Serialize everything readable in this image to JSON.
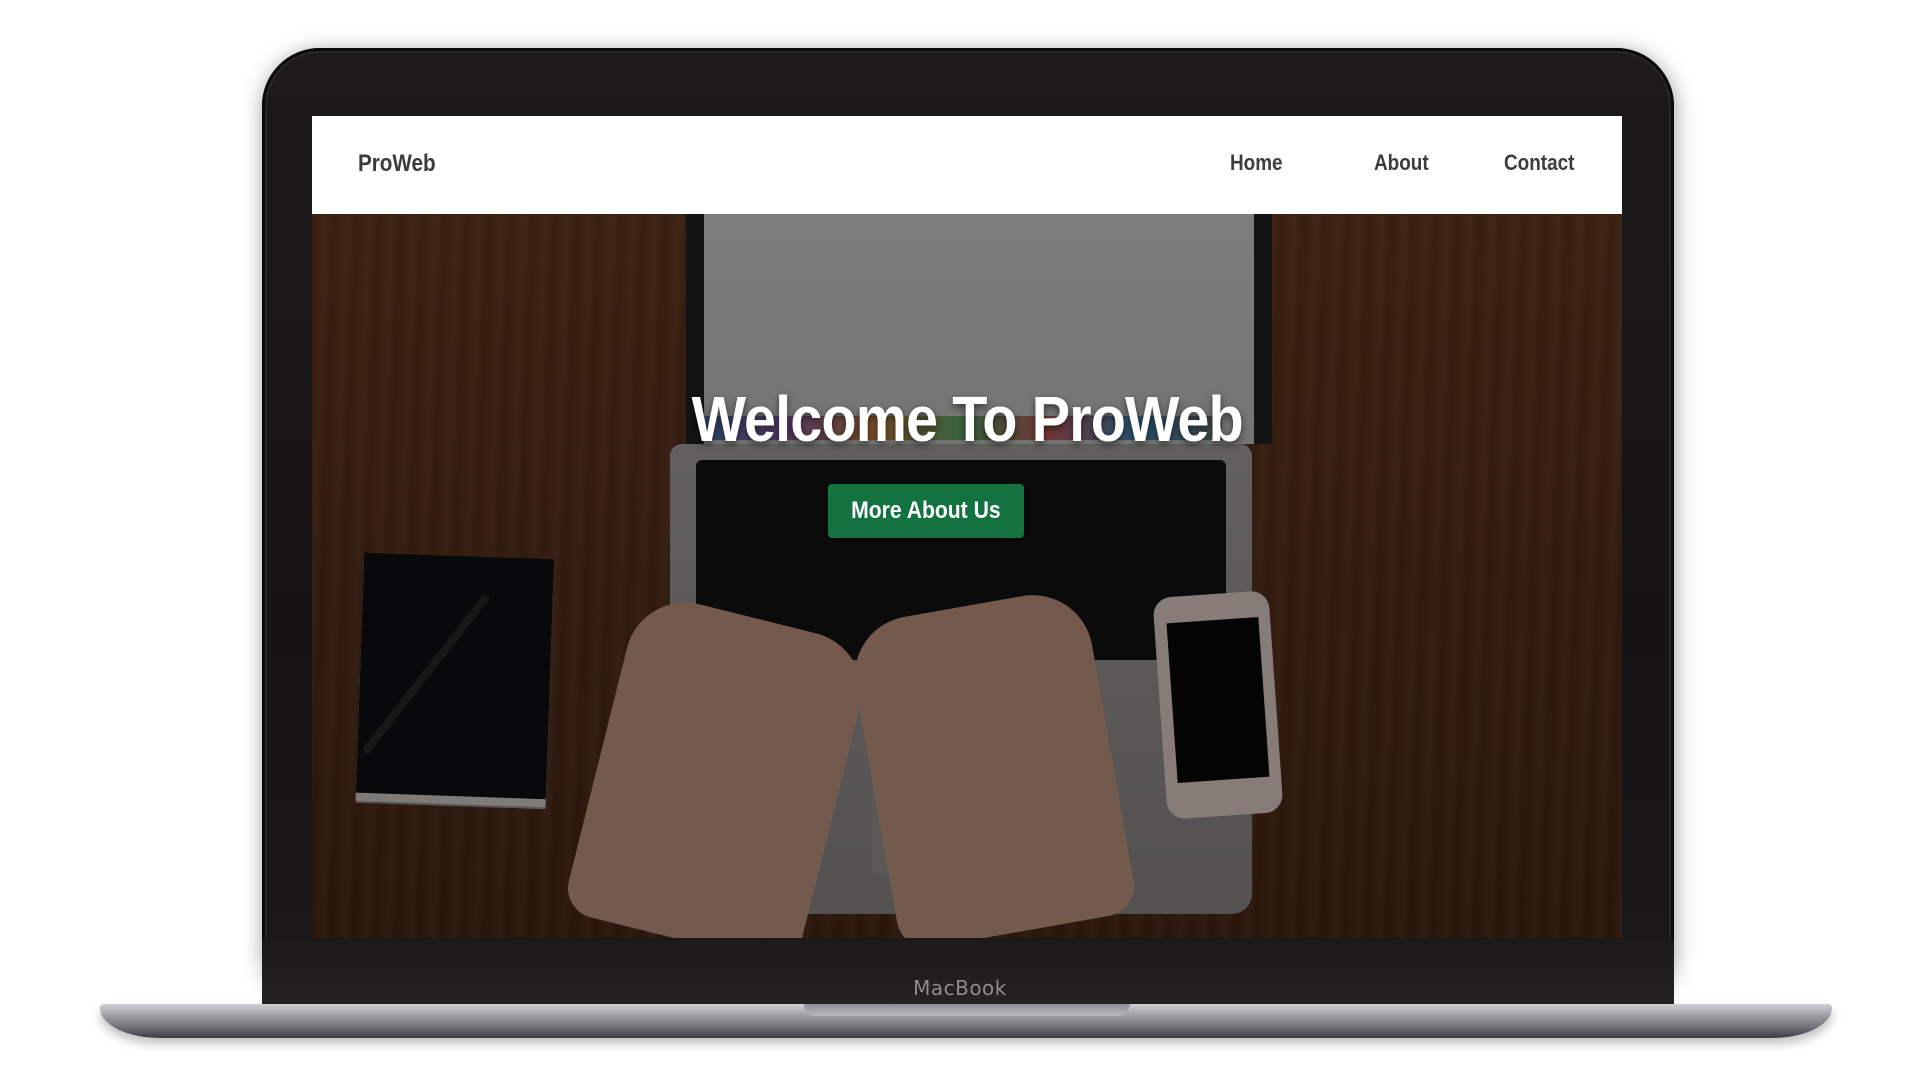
{
  "device": {
    "label": "MacBook"
  },
  "site": {
    "brand": "ProWeb",
    "nav": [
      {
        "label": "Home"
      },
      {
        "label": "About"
      },
      {
        "label": "Contact"
      }
    ],
    "hero": {
      "title": "Welcome To ProWeb",
      "button_label": "More About Us"
    }
  },
  "colors": {
    "nav_background": "#ffffff",
    "nav_text": "#3d3d3d",
    "button_background": "#137240",
    "button_text": "#ffffff",
    "hero_title": "#ffffff",
    "laptop_frame": "#1a1818"
  }
}
